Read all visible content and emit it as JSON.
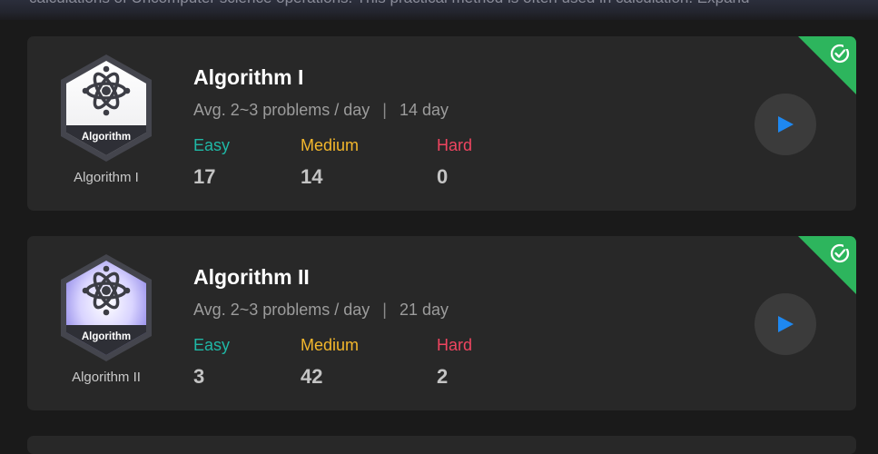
{
  "banner_text": "calculations of Uncomputer science operations. This practical method is often used in calculation. Expand",
  "cards": [
    {
      "title": "Algorithm I",
      "badge_label": "Algorithm",
      "badge_name": "Algorithm I",
      "avg": "Avg. 2~3 problems / day",
      "separator": "|",
      "days": "14 day",
      "easy_label": "Easy",
      "medium_label": "Medium",
      "hard_label": "Hard",
      "easy": "17",
      "medium": "14",
      "hard": "0",
      "completed": true
    },
    {
      "title": "Algorithm II",
      "badge_label": "Algorithm",
      "badge_name": "Algorithm II",
      "avg": "Avg. 2~3 problems / day",
      "separator": "|",
      "days": "21 day",
      "easy_label": "Easy",
      "medium_label": "Medium",
      "hard_label": "Hard",
      "easy": "3",
      "medium": "42",
      "hard": "2",
      "completed": true
    }
  ],
  "colors": {
    "easy": "#1fb8a6",
    "medium": "#f3b72c",
    "hard": "#ef4560",
    "play_arrow": "#1e88f0",
    "completed_corner": "#2db55d"
  },
  "icons": {
    "badge": "atom-icon",
    "play": "play-icon",
    "completed": "check-circle-icon"
  }
}
